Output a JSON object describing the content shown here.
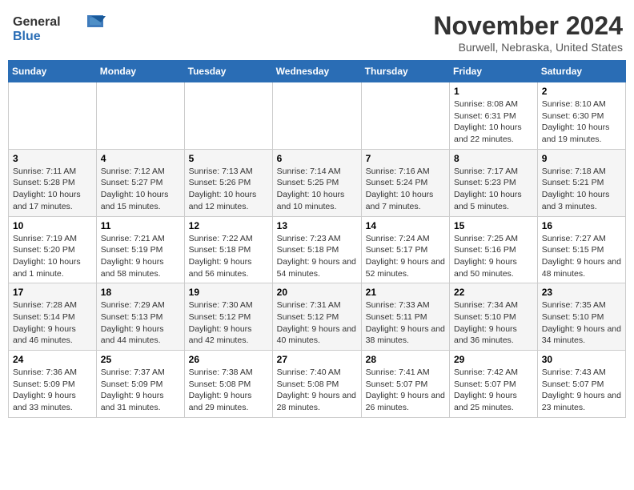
{
  "header": {
    "logo_line1": "General",
    "logo_line2": "Blue",
    "month": "November 2024",
    "location": "Burwell, Nebraska, United States"
  },
  "weekdays": [
    "Sunday",
    "Monday",
    "Tuesday",
    "Wednesday",
    "Thursday",
    "Friday",
    "Saturday"
  ],
  "weeks": [
    [
      {
        "day": "",
        "info": ""
      },
      {
        "day": "",
        "info": ""
      },
      {
        "day": "",
        "info": ""
      },
      {
        "day": "",
        "info": ""
      },
      {
        "day": "",
        "info": ""
      },
      {
        "day": "1",
        "info": "Sunrise: 8:08 AM\nSunset: 6:31 PM\nDaylight: 10 hours and 22 minutes."
      },
      {
        "day": "2",
        "info": "Sunrise: 8:10 AM\nSunset: 6:30 PM\nDaylight: 10 hours and 19 minutes."
      }
    ],
    [
      {
        "day": "3",
        "info": "Sunrise: 7:11 AM\nSunset: 5:28 PM\nDaylight: 10 hours and 17 minutes."
      },
      {
        "day": "4",
        "info": "Sunrise: 7:12 AM\nSunset: 5:27 PM\nDaylight: 10 hours and 15 minutes."
      },
      {
        "day": "5",
        "info": "Sunrise: 7:13 AM\nSunset: 5:26 PM\nDaylight: 10 hours and 12 minutes."
      },
      {
        "day": "6",
        "info": "Sunrise: 7:14 AM\nSunset: 5:25 PM\nDaylight: 10 hours and 10 minutes."
      },
      {
        "day": "7",
        "info": "Sunrise: 7:16 AM\nSunset: 5:24 PM\nDaylight: 10 hours and 7 minutes."
      },
      {
        "day": "8",
        "info": "Sunrise: 7:17 AM\nSunset: 5:23 PM\nDaylight: 10 hours and 5 minutes."
      },
      {
        "day": "9",
        "info": "Sunrise: 7:18 AM\nSunset: 5:21 PM\nDaylight: 10 hours and 3 minutes."
      }
    ],
    [
      {
        "day": "10",
        "info": "Sunrise: 7:19 AM\nSunset: 5:20 PM\nDaylight: 10 hours and 1 minute."
      },
      {
        "day": "11",
        "info": "Sunrise: 7:21 AM\nSunset: 5:19 PM\nDaylight: 9 hours and 58 minutes."
      },
      {
        "day": "12",
        "info": "Sunrise: 7:22 AM\nSunset: 5:18 PM\nDaylight: 9 hours and 56 minutes."
      },
      {
        "day": "13",
        "info": "Sunrise: 7:23 AM\nSunset: 5:18 PM\nDaylight: 9 hours and 54 minutes."
      },
      {
        "day": "14",
        "info": "Sunrise: 7:24 AM\nSunset: 5:17 PM\nDaylight: 9 hours and 52 minutes."
      },
      {
        "day": "15",
        "info": "Sunrise: 7:25 AM\nSunset: 5:16 PM\nDaylight: 9 hours and 50 minutes."
      },
      {
        "day": "16",
        "info": "Sunrise: 7:27 AM\nSunset: 5:15 PM\nDaylight: 9 hours and 48 minutes."
      }
    ],
    [
      {
        "day": "17",
        "info": "Sunrise: 7:28 AM\nSunset: 5:14 PM\nDaylight: 9 hours and 46 minutes."
      },
      {
        "day": "18",
        "info": "Sunrise: 7:29 AM\nSunset: 5:13 PM\nDaylight: 9 hours and 44 minutes."
      },
      {
        "day": "19",
        "info": "Sunrise: 7:30 AM\nSunset: 5:12 PM\nDaylight: 9 hours and 42 minutes."
      },
      {
        "day": "20",
        "info": "Sunrise: 7:31 AM\nSunset: 5:12 PM\nDaylight: 9 hours and 40 minutes."
      },
      {
        "day": "21",
        "info": "Sunrise: 7:33 AM\nSunset: 5:11 PM\nDaylight: 9 hours and 38 minutes."
      },
      {
        "day": "22",
        "info": "Sunrise: 7:34 AM\nSunset: 5:10 PM\nDaylight: 9 hours and 36 minutes."
      },
      {
        "day": "23",
        "info": "Sunrise: 7:35 AM\nSunset: 5:10 PM\nDaylight: 9 hours and 34 minutes."
      }
    ],
    [
      {
        "day": "24",
        "info": "Sunrise: 7:36 AM\nSunset: 5:09 PM\nDaylight: 9 hours and 33 minutes."
      },
      {
        "day": "25",
        "info": "Sunrise: 7:37 AM\nSunset: 5:09 PM\nDaylight: 9 hours and 31 minutes."
      },
      {
        "day": "26",
        "info": "Sunrise: 7:38 AM\nSunset: 5:08 PM\nDaylight: 9 hours and 29 minutes."
      },
      {
        "day": "27",
        "info": "Sunrise: 7:40 AM\nSunset: 5:08 PM\nDaylight: 9 hours and 28 minutes."
      },
      {
        "day": "28",
        "info": "Sunrise: 7:41 AM\nSunset: 5:07 PM\nDaylight: 9 hours and 26 minutes."
      },
      {
        "day": "29",
        "info": "Sunrise: 7:42 AM\nSunset: 5:07 PM\nDaylight: 9 hours and 25 minutes."
      },
      {
        "day": "30",
        "info": "Sunrise: 7:43 AM\nSunset: 5:07 PM\nDaylight: 9 hours and 23 minutes."
      }
    ]
  ]
}
